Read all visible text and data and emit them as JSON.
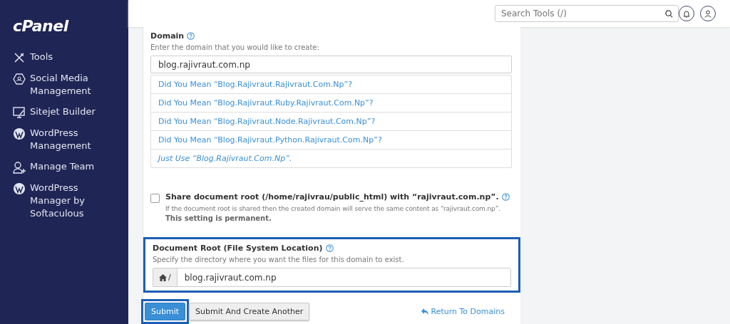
{
  "sidebar": {
    "logo": "cPanel",
    "items": [
      {
        "label": "Tools",
        "kind": "tools"
      },
      {
        "label": "Social Media Management",
        "kind": "social"
      },
      {
        "label": "Sitejet Builder",
        "kind": "builder"
      },
      {
        "label": "WordPress Management",
        "kind": "wordpress"
      },
      {
        "label": "Manage Team",
        "kind": "team"
      },
      {
        "label": "WordPress Manager by Softaculous",
        "kind": "wordpress"
      }
    ]
  },
  "header": {
    "search": {
      "placeholder": "Search Tools (/)"
    }
  },
  "domain": {
    "label": "Domain",
    "hint": "Enter the domain that you would like to create:",
    "value": "blog.rajivraut.com.np",
    "suggestions": [
      {
        "text": "Did You Mean “Blog.Rajivraut.Rajivraut.Com.Np”?",
        "kind": "suggestion"
      },
      {
        "text": "Did You Mean “Blog.Rajivraut.Ruby.Rajivraut.Com.Np”?",
        "kind": "suggestion"
      },
      {
        "text": "Did You Mean “Blog.Rajivraut.Node.Rajivraut.Com.Np”?",
        "kind": "suggestion"
      },
      {
        "text": "Did You Mean “Blog.Rajivraut.Python.Rajivraut.Com.Np”?",
        "kind": "suggestion"
      },
      {
        "text": "Just Use “Blog.Rajivraut.Com.Np”.",
        "kind": "fallback"
      }
    ]
  },
  "share": {
    "checked": false,
    "label": "Share document root (/home/rajivrau/public_html) with “rajivraut.com.np”.",
    "note": "If the document root is shared then the created domain will serve the same content as “rajivraut.com.np”.",
    "warning": "This setting is permanent."
  },
  "doc_root": {
    "highlighted": true,
    "label": "Document Root (File System Location)",
    "hint": "Specify the directory where you want the files for this domain to exist.",
    "prefix": "/",
    "value": "blog.rajivraut.com.np"
  },
  "buttons": [
    {
      "label": "Submit",
      "kind": "primary",
      "highlighted": true
    },
    {
      "label": "Submit And Create Another",
      "kind": "default",
      "highlighted": false
    }
  ],
  "return_link": "Return To Domains"
}
